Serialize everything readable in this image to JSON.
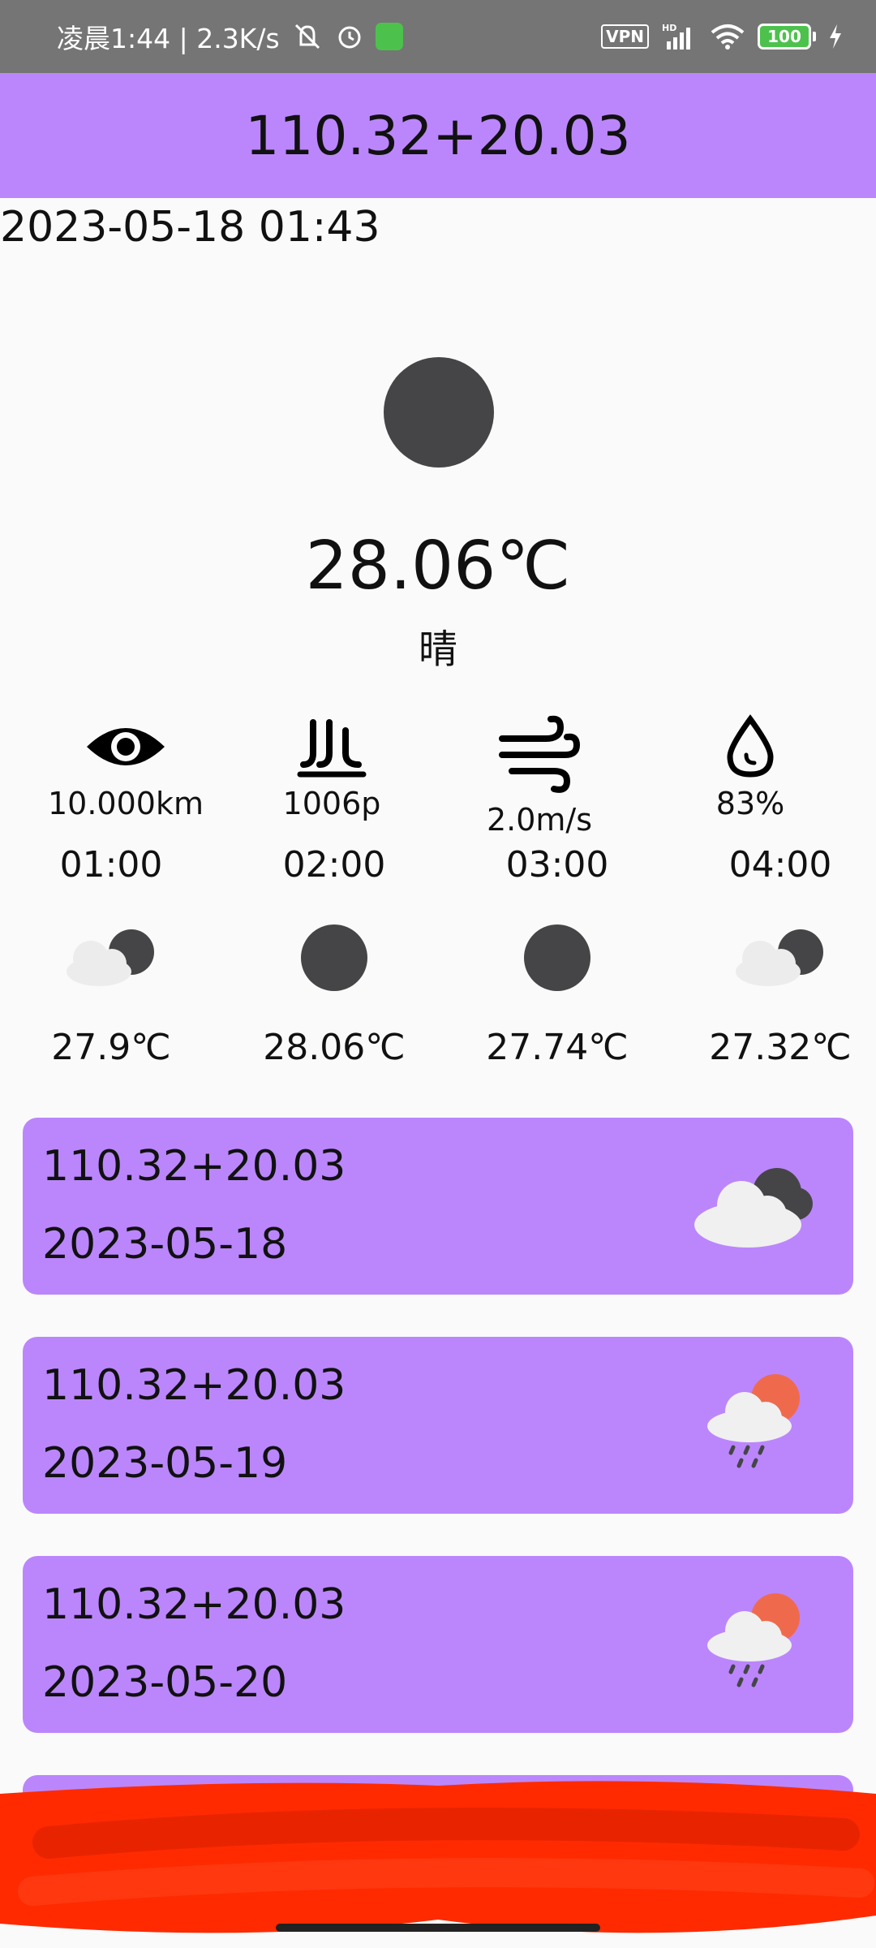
{
  "status_bar": {
    "time_speed": "凌晨1:44 | 2.3K/s",
    "vpn": "VPN",
    "network": "HD",
    "battery": "100"
  },
  "app_bar": {
    "title": "110.32+20.03"
  },
  "current": {
    "datetime": "2023-05-18 01:43",
    "temperature": "28.06℃",
    "condition": "晴",
    "icon": "moon-icon"
  },
  "metrics": [
    {
      "icon": "eye-icon",
      "value": "10.000km"
    },
    {
      "icon": "pressure-icon",
      "value": "1006p"
    },
    {
      "icon": "wind-icon",
      "value": "2.0m/s"
    },
    {
      "icon": "humidity-icon",
      "value": "83%"
    }
  ],
  "hourly": [
    {
      "time": "01:00",
      "icon": "cloudy-night-icon",
      "temp": "27.9℃"
    },
    {
      "time": "02:00",
      "icon": "moon-icon",
      "temp": "28.06℃"
    },
    {
      "time": "03:00",
      "icon": "moon-icon",
      "temp": "27.74℃"
    },
    {
      "time": "04:00",
      "icon": "cloudy-night-icon",
      "temp": "27.32℃"
    }
  ],
  "daily": [
    {
      "location": "110.32+20.03",
      "date": "2023-05-18",
      "icon": "cloudy-night-icon"
    },
    {
      "location": "110.32+20.03",
      "date": "2023-05-19",
      "icon": "rain-sun-icon"
    },
    {
      "location": "110.32+20.03",
      "date": "2023-05-20",
      "icon": "rain-sun-icon"
    }
  ],
  "colors": {
    "accent": "#bb86fc",
    "moon": "#454547",
    "sun": "#ef6a4d",
    "redaction": "#ff2a00"
  }
}
